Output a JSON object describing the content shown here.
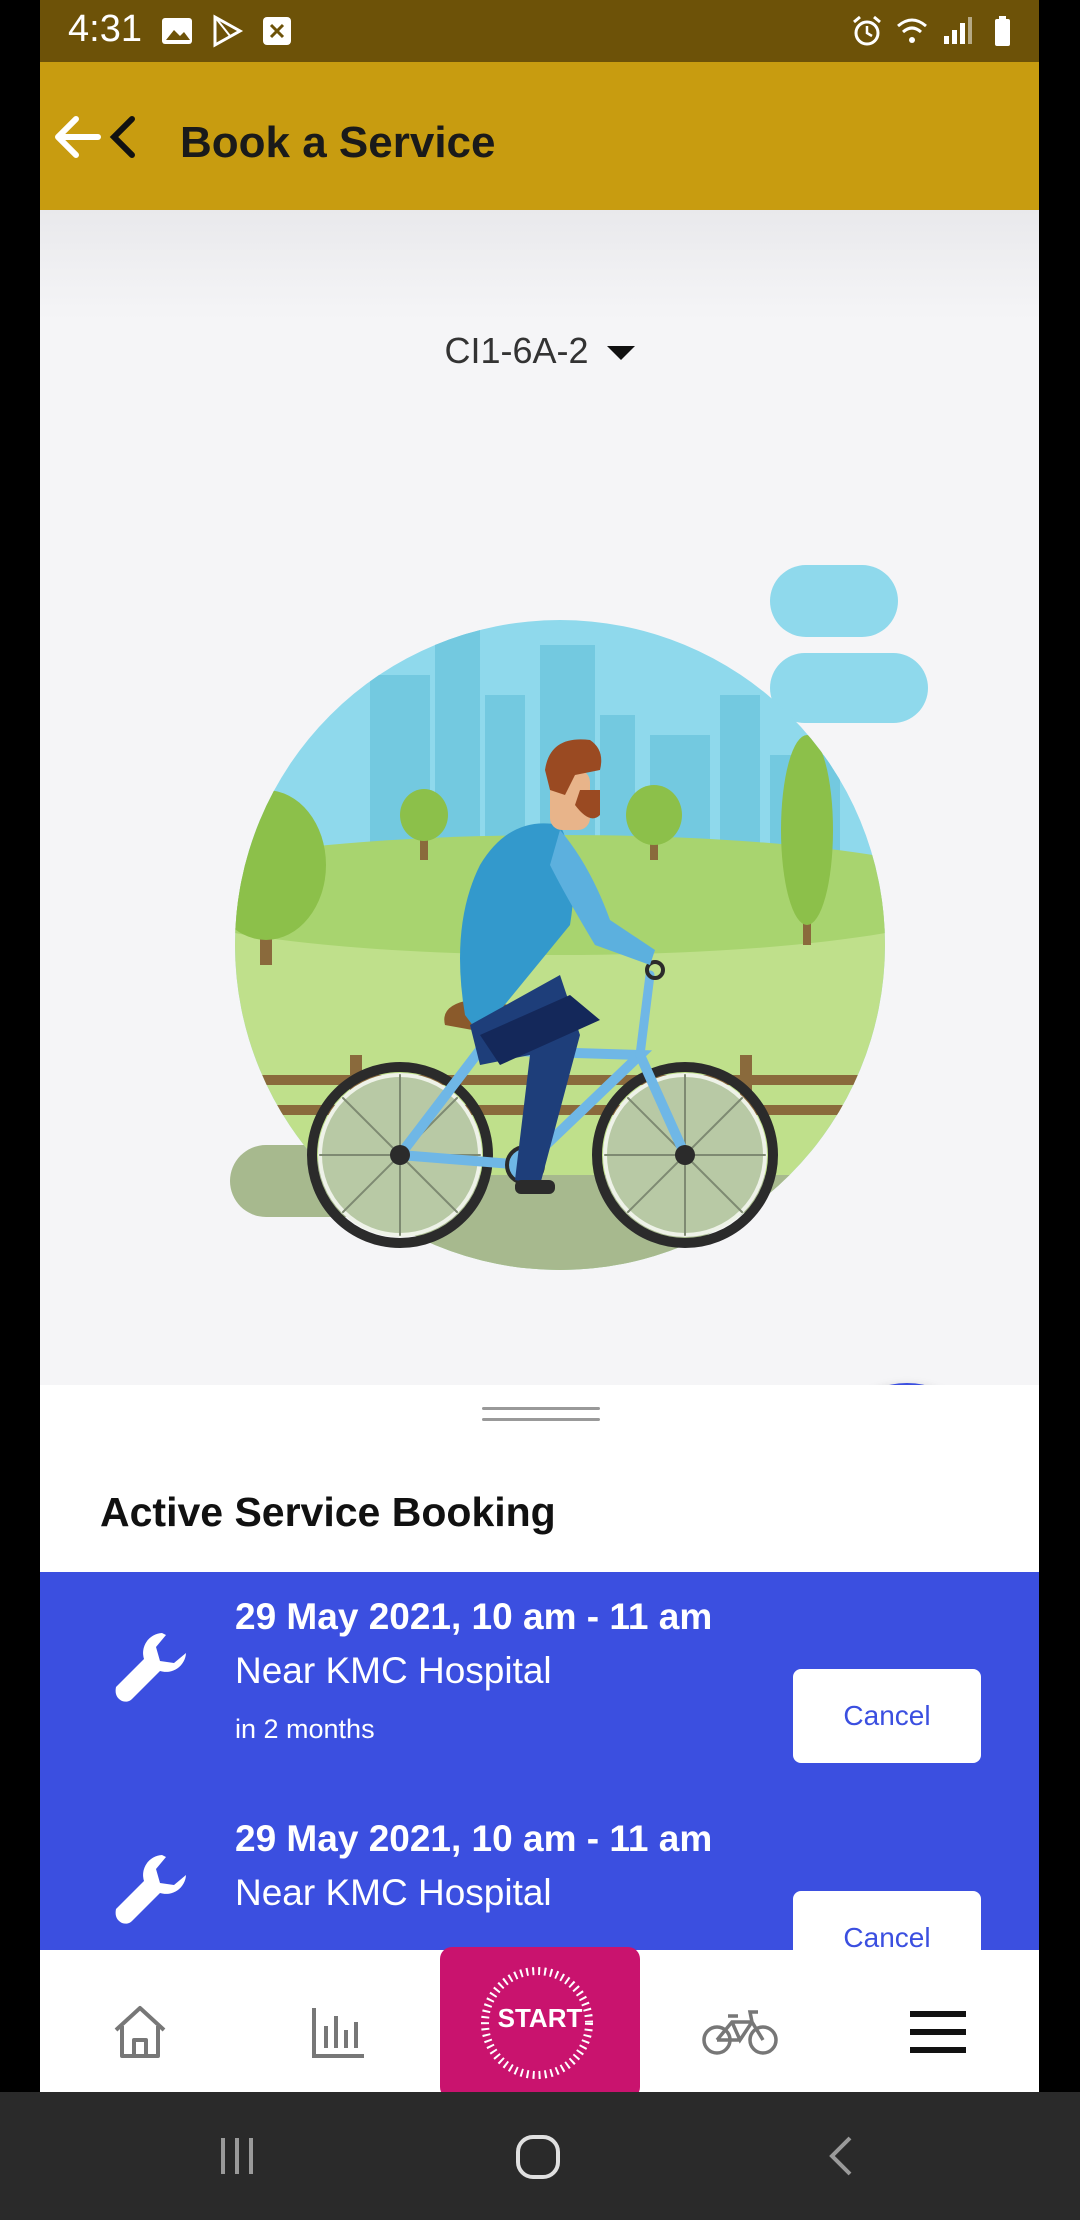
{
  "status_bar": {
    "time": "4:31",
    "icons": [
      "image-icon",
      "play-store-icon",
      "close-box-icon",
      "alarm-icon",
      "wifi-icon",
      "signal-icon",
      "battery-icon"
    ]
  },
  "app_bar": {
    "title": "Book a Service",
    "back_icon": "back-arrow-icon"
  },
  "vehicle_selector": {
    "value": "CI1-6A-2",
    "icon": "dropdown-caret-icon"
  },
  "illustration": "man-riding-bicycle-in-park",
  "fab": {
    "icon": "plus-icon",
    "color": "#3b4fe0"
  },
  "sheet": {
    "title": "Active Service Booking",
    "bookings": [
      {
        "date_time": "29 May 2021, 10 am - 11 am",
        "location": "Near KMC Hospital",
        "relative": "in 2 months",
        "cancel_label": "Cancel"
      },
      {
        "date_time": "29 May 2021, 10 am - 11 am",
        "location": "Near KMC Hospital",
        "relative": "",
        "cancel_label": "Cancel"
      }
    ]
  },
  "bottom_nav": {
    "items": [
      "home-icon",
      "stats-icon",
      "start-button",
      "bicycle-icon",
      "menu-icon"
    ],
    "start_label": "START"
  },
  "colors": {
    "app_bar": "#c89c10",
    "status_bar": "#6d5208",
    "primary_blue": "#3b4fe0",
    "start_button": "#c9136e"
  }
}
